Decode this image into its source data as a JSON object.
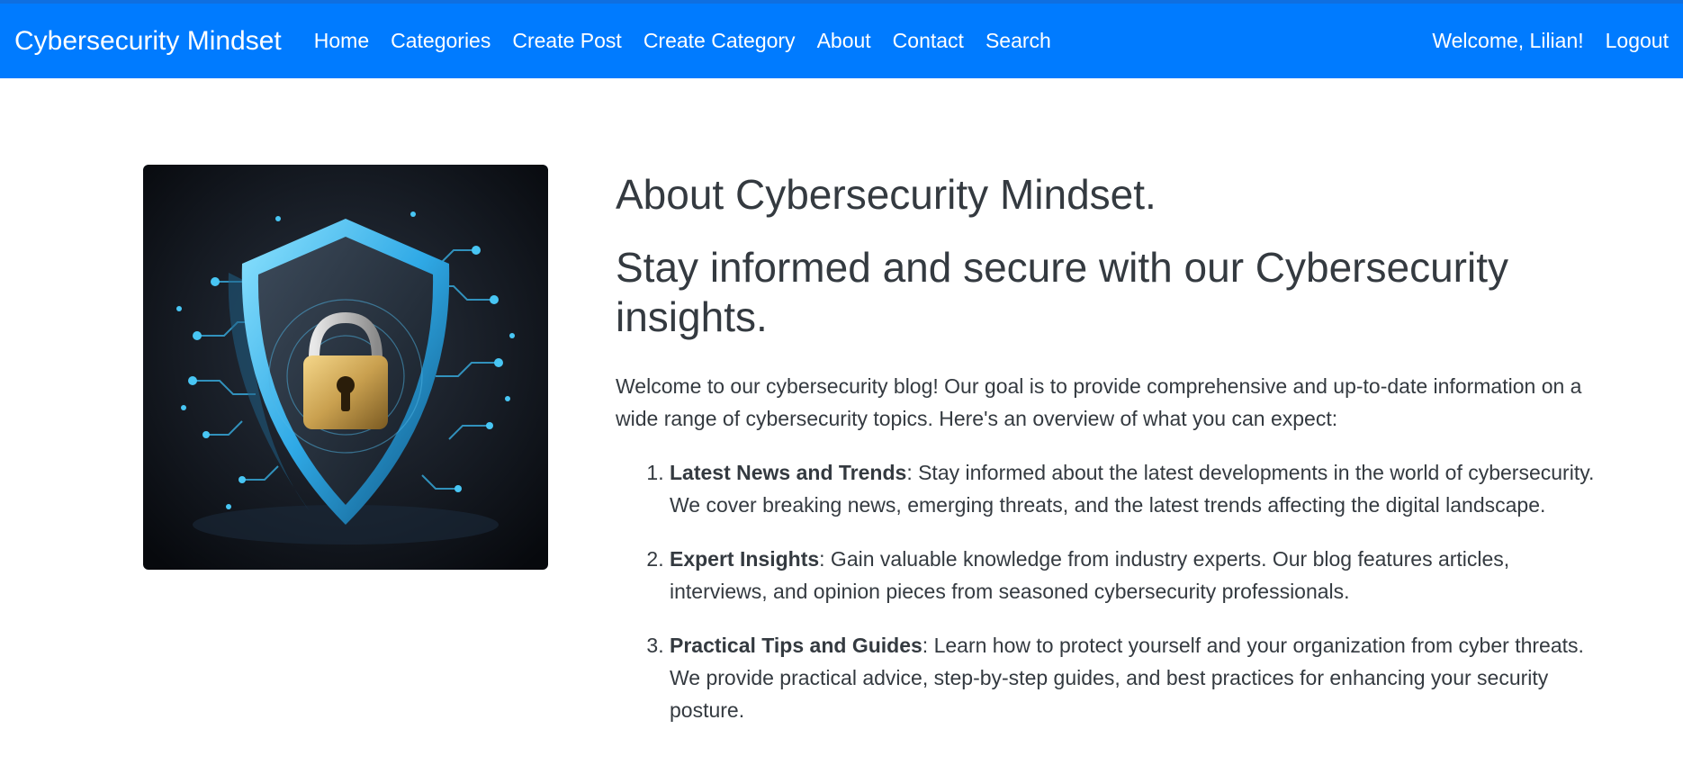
{
  "navbar": {
    "brand": "Cybersecurity Mindset",
    "links": [
      "Home",
      "Categories",
      "Create Post",
      "Create Category",
      "About",
      "Contact",
      "Search"
    ],
    "welcome": "Welcome, Lilian!",
    "logout": "Logout",
    "color": "#007bff"
  },
  "image": {
    "icon": "cyber-shield-padlock-image"
  },
  "main": {
    "title": "About Cybersecurity Mindset.",
    "subtitle": "Stay informed and secure with our Cybersecurity insights.",
    "intro": "Welcome to our cybersecurity blog! Our goal is to provide comprehensive and up-to-date information on a wide range of cybersecurity topics. Here's an overview of what you can expect:",
    "items": [
      {
        "heading": "Latest News and Trends",
        "text": ": Stay informed about the latest developments in the world of cybersecurity. We cover breaking news, emerging threats, and the latest trends affecting the digital landscape."
      },
      {
        "heading": "Expert Insights",
        "text": ": Gain valuable knowledge from industry experts. Our blog features articles, interviews, and opinion pieces from seasoned cybersecurity professionals."
      },
      {
        "heading": "Practical Tips and Guides",
        "text": ": Learn how to protect yourself and your organization from cyber threats. We provide practical advice, step-by-step guides, and best practices for enhancing your security posture."
      }
    ]
  }
}
